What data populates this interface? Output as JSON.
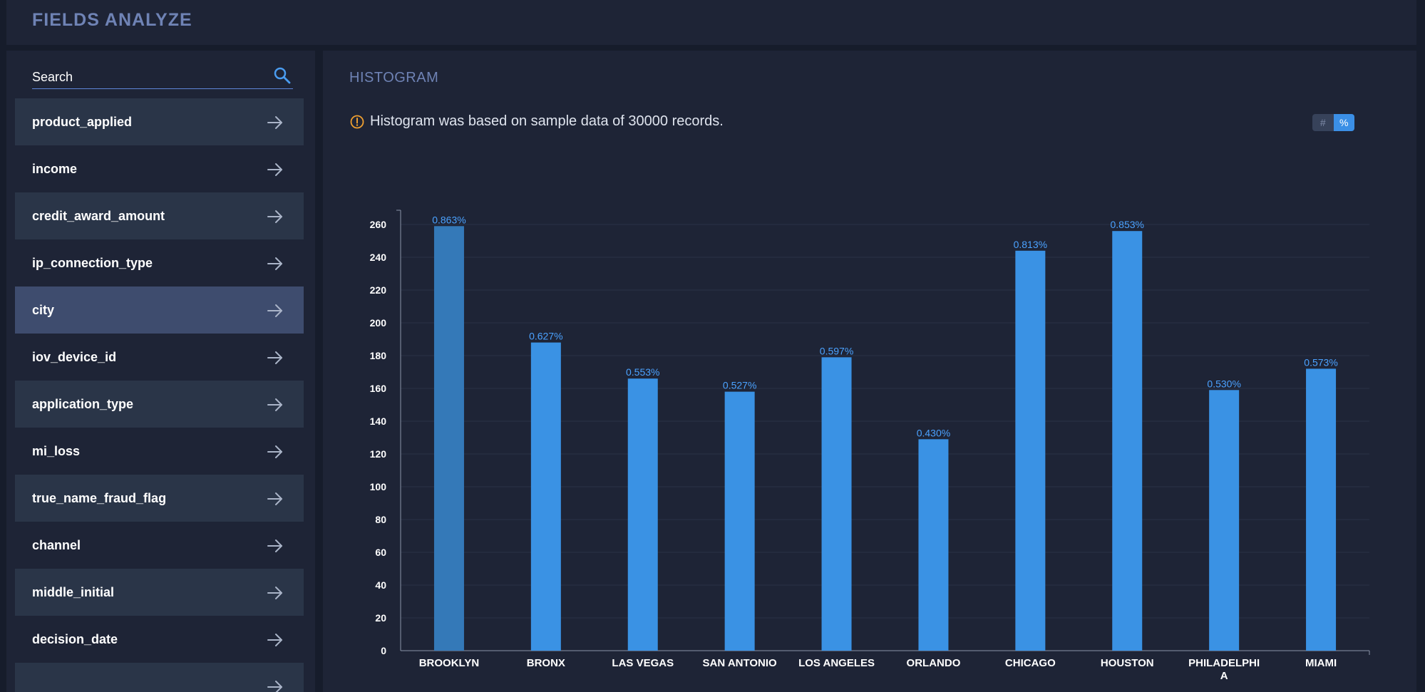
{
  "header": {
    "title": "FIELDS ANALYZE"
  },
  "sidebar": {
    "search_placeholder": "Search",
    "items": [
      {
        "label": "product_applied"
      },
      {
        "label": "income"
      },
      {
        "label": "credit_award_amount"
      },
      {
        "label": "ip_connection_type"
      },
      {
        "label": "city",
        "active": true
      },
      {
        "label": "iov_device_id"
      },
      {
        "label": "application_type"
      },
      {
        "label": "mi_loss"
      },
      {
        "label": "true_name_fraud_flag"
      },
      {
        "label": "channel"
      },
      {
        "label": "middle_initial"
      },
      {
        "label": "decision_date"
      },
      {
        "label": ""
      }
    ]
  },
  "main": {
    "section_title": "HISTOGRAM",
    "notice": "Histogram was based on sample data of 30000 records.",
    "toggle": {
      "count_label": "#",
      "percent_label": "%",
      "selected": "%"
    }
  },
  "colors": {
    "bar": "#3a92e4",
    "bar_highlight": "#3479b8",
    "label": "#4ba2ff",
    "warning": "#f0a030"
  },
  "chart_data": {
    "type": "bar",
    "categories": [
      "BROOKLYN",
      "BRONX",
      "LAS VEGAS",
      "SAN ANTONIO",
      "LOS ANGELES",
      "ORLANDO",
      "CHICAGO",
      "HOUSTON",
      "PHILADELPHIA",
      "MIAMI"
    ],
    "category_display": [
      [
        "BROOKLYN"
      ],
      [
        "BRONX"
      ],
      [
        "LAS VEGAS"
      ],
      [
        "SAN ANTONIO"
      ],
      [
        "LOS ANGELES"
      ],
      [
        "ORLANDO"
      ],
      [
        "CHICAGO"
      ],
      [
        "HOUSTON"
      ],
      [
        "PHILADELPHI",
        "A"
      ],
      [
        "MIAMI"
      ]
    ],
    "values": [
      259,
      188,
      166,
      158,
      179,
      129,
      244,
      256,
      159,
      172
    ],
    "data_labels": [
      "0.863%",
      "0.627%",
      "0.553%",
      "0.527%",
      "0.597%",
      "0.430%",
      "0.813%",
      "0.853%",
      "0.530%",
      "0.573%"
    ],
    "highlight_index": 0,
    "ylim": [
      0,
      260
    ],
    "yticks": [
      0,
      20,
      40,
      60,
      80,
      100,
      120,
      140,
      160,
      180,
      200,
      220,
      240,
      260
    ],
    "grid": true
  }
}
